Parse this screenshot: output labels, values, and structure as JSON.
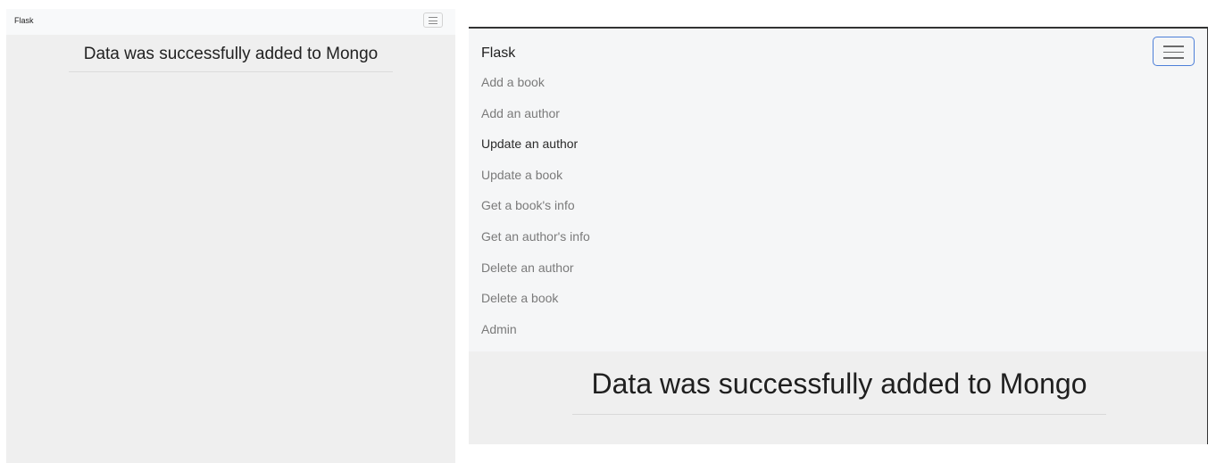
{
  "left_view": {
    "navbar": {
      "brand": "Flask",
      "toggler": "menu-icon"
    },
    "main": {
      "heading": "Data was successfully added to Mongo"
    }
  },
  "right_view": {
    "navbar": {
      "brand": "Flask",
      "toggler": "menu-icon",
      "accent_color": "#4d7fd8",
      "items": [
        {
          "label": "Add a book"
        },
        {
          "label": "Add an author"
        },
        {
          "label": "Update an author"
        },
        {
          "label": "Update a book"
        },
        {
          "label": "Get a book's info"
        },
        {
          "label": "Get an author's info"
        },
        {
          "label": "Delete an author"
        },
        {
          "label": "Delete a book"
        },
        {
          "label": "Admin"
        }
      ]
    },
    "main": {
      "heading": "Data was successfully added to Mongo"
    }
  }
}
